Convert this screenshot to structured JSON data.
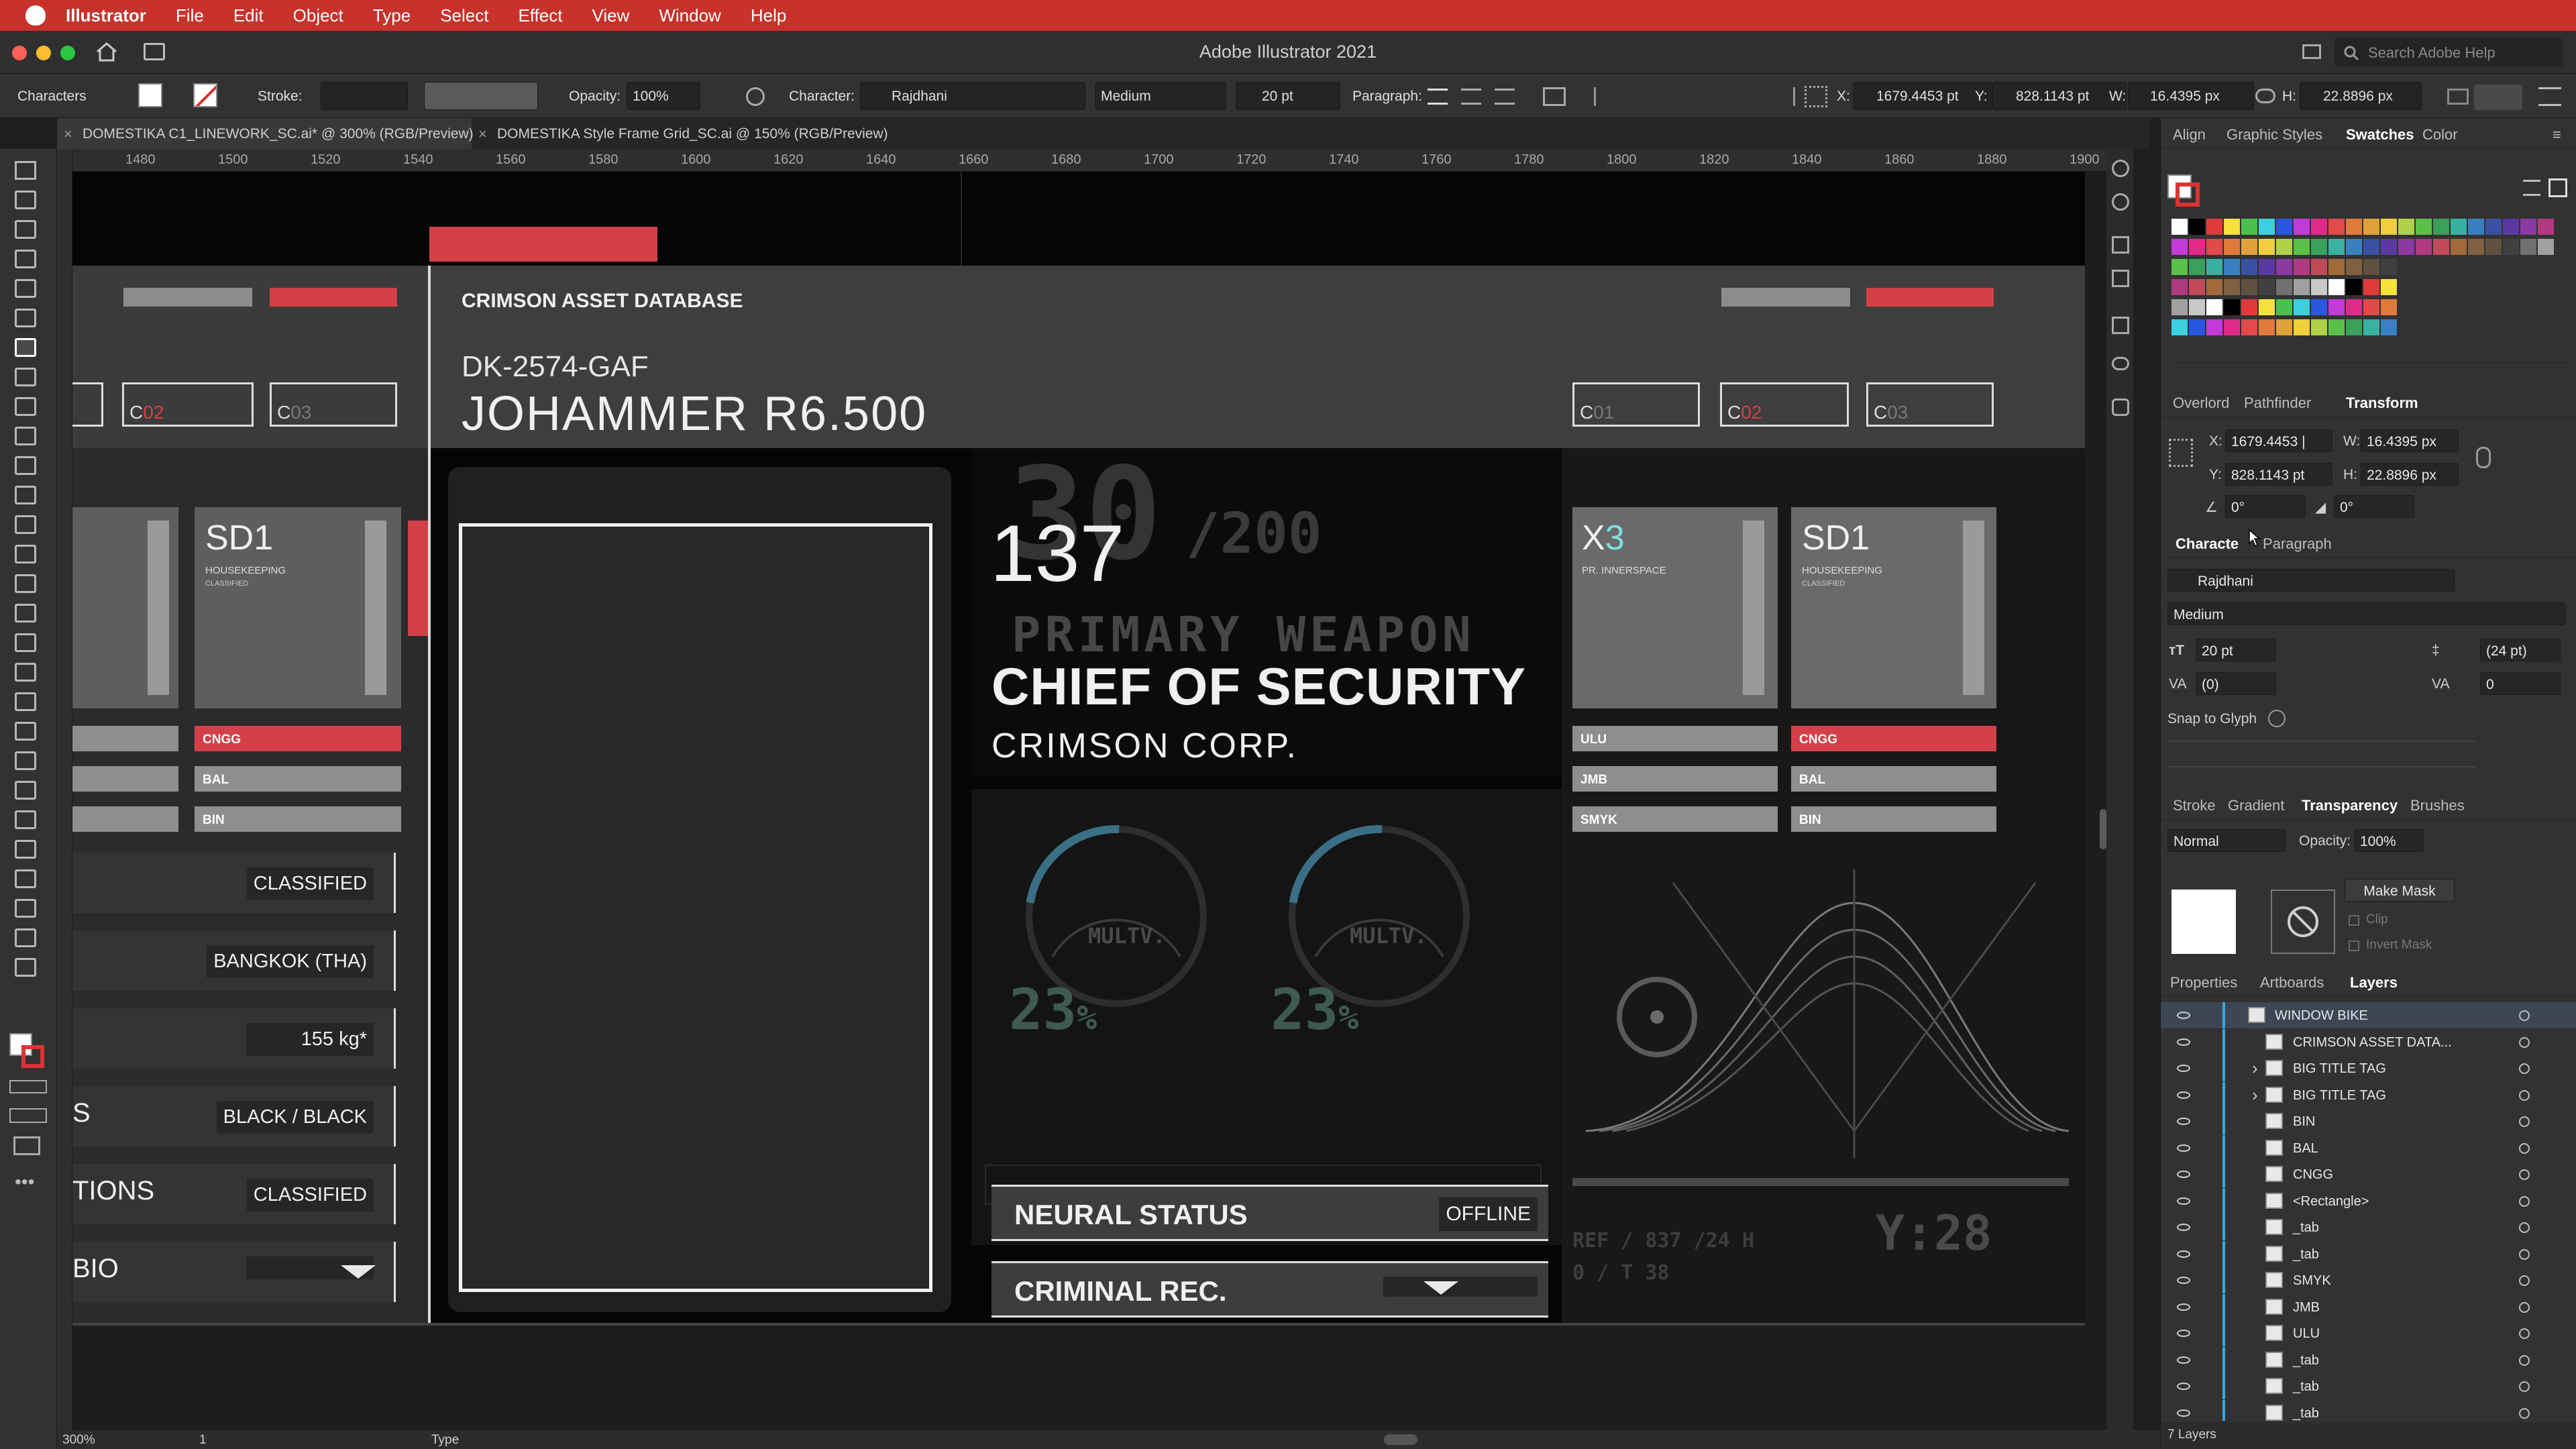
{
  "menubar": {
    "app": "Illustrator",
    "items": [
      "File",
      "Edit",
      "Object",
      "Type",
      "Select",
      "Effect",
      "View",
      "Window",
      "Help"
    ]
  },
  "window": {
    "title": "Adobe Illustrator 2021",
    "search_placeholder": "Search Adobe Help"
  },
  "control_bar": {
    "selection_label": "Characters",
    "stroke_label": "Stroke:",
    "opacity_label": "Opacity:",
    "opacity_value": "100%",
    "character_label": "Character:",
    "font_family": "Rajdhani",
    "font_style": "Medium",
    "font_size": "20 pt",
    "paragraph_label": "Paragraph:",
    "x_label": "X:",
    "x_value": "1679.4453 pt",
    "y_label": "Y:",
    "y_value": "828.1143 pt",
    "w_label": "W:",
    "w_value": "16.4395 px",
    "h_label": "H:",
    "h_value": "22.8896 px"
  },
  "tabs": [
    {
      "label": "DOMESTIKA C1_LINEWORK_SC.ai* @ 300% (RGB/Preview)",
      "active": true
    },
    {
      "label": "DOMESTIKA Style Frame Grid_SC.ai @ 150% (RGB/Preview)",
      "active": false
    }
  ],
  "ruler_top": [
    "1480",
    "1500",
    "1520",
    "1540",
    "1560",
    "1580",
    "1600",
    "1620",
    "1640",
    "1660",
    "1680",
    "1700",
    "1720",
    "1740",
    "1760",
    "1780",
    "1800",
    "1820",
    "1840",
    "1860",
    "1880",
    "1900"
  ],
  "artwork": {
    "header": "CRIMSON ASSET DATABASE",
    "id_code": "DK-2574-GAF",
    "name": "JOHAMMER R6.500",
    "left_codes": [
      {
        "prefix": "C",
        "red": "02",
        "grey": ""
      },
      {
        "prefix": "C",
        "red": "",
        "grey": "03"
      }
    ],
    "right_codes": [
      {
        "prefix": "C",
        "red": "",
        "grey": "01"
      },
      {
        "prefix": "C",
        "red": "02",
        "grey": ""
      },
      {
        "prefix": "C",
        "red": "",
        "grey": "03"
      }
    ],
    "left_card": {
      "title": "SD1",
      "sub": "HOUSEKEEPING",
      "sub2": "CLASSIFIED"
    },
    "left_tags": [
      "CNGG",
      "BAL",
      "BIN"
    ],
    "fields": [
      {
        "label": "",
        "value": "CLASSIFIED"
      },
      {
        "label": "",
        "value": "BANGKOK (THA)"
      },
      {
        "label": "",
        "value": "155 kg*"
      },
      {
        "label": "S",
        "value": "BLACK / BLACK"
      },
      {
        "label": "TIONS",
        "value": "CLASSIFIED"
      },
      {
        "label": "BIO",
        "value": ""
      }
    ],
    "big_number": "137",
    "ghost_number": "30",
    "ghost_denominator": "/200",
    "ghost_primary": "PRIMARY WEAPON",
    "role": "CHIEF OF SECURITY",
    "company": "CRIMSON CORP.",
    "gauges": [
      {
        "label": "MULTV.",
        "percent": "23",
        "unit": "%",
        "fill": 0.23
      },
      {
        "label": "MULTV.",
        "percent": "23",
        "unit": "%",
        "fill": 0.23
      }
    ],
    "status_rows": [
      {
        "label": "NEURAL STATUS",
        "value": "OFFLINE"
      },
      {
        "label": "CRIMINAL REC.",
        "value": ""
      }
    ],
    "right_cards": [
      {
        "title_prefix": "X",
        "title_accent": "3",
        "sub": "PR. INNERSPACE"
      },
      {
        "title_prefix": "SD",
        "title_accent": "1",
        "sub": "HOUSEKEEPING",
        "sub2": "CLASSIFIED"
      }
    ],
    "right_tags_left": [
      "ULU",
      "JMB",
      "SMYK"
    ],
    "right_tags_right": [
      "CNGG",
      "BAL",
      "BIN"
    ],
    "ghost_ref": "REF / 837 /24 H",
    "ghost_ref2": "0 / T 38",
    "ghost_y": "Y:28"
  },
  "dock": {
    "top_tabs": [
      "Align",
      "Graphic Styles",
      "Swatches",
      "Color"
    ],
    "transform_tabs": [
      "Overlord",
      "Pathfinder",
      "Transform"
    ],
    "transform": {
      "x": "1679.4453 |",
      "y": "828.1143 pt",
      "w": "16.4395 px",
      "h": "22.8896 px",
      "angle": "0°",
      "shear": "0°"
    },
    "char_tabs": [
      "Characte",
      "Paragraph"
    ],
    "character": {
      "font": "Rajdhani",
      "style": "Medium",
      "size": "20 pt",
      "leading": "(24 pt)",
      "kerning": "(0)",
      "tracking": "0"
    },
    "snap_label": "Snap to Glyph",
    "lower_tabs": [
      "Stroke",
      "Gradient",
      "Transparency",
      "Brushes"
    ],
    "transparency": {
      "blend": "Normal",
      "opacity_label": "Opacity:",
      "opacity": "100%",
      "make_mask": "Make Mask",
      "clip": "Clip",
      "invert": "Invert Mask"
    },
    "layer_tabs": [
      "Properties",
      "Artboards",
      "Layers"
    ],
    "layers": [
      "WINDOW BIKE",
      "CRIMSON ASSET DATA...",
      "BIG TITLE TAG",
      "BIG TITLE TAG",
      "BIN",
      "BAL",
      "CNGG",
      "<Rectangle>",
      "_tab",
      "_tab",
      "SMYK",
      "JMB",
      "ULU",
      "_tab",
      "_tab",
      "_tab"
    ],
    "layers_count": "7 Layers"
  },
  "statusbar": {
    "zoom": "300%",
    "page": "1",
    "tool": "Type"
  },
  "colors": {
    "menubar": "#c8322b",
    "accent_red": "#d44048",
    "artboard": "#050505",
    "panel_bg": "#323232",
    "layer_bar": "#3aa8e0"
  }
}
